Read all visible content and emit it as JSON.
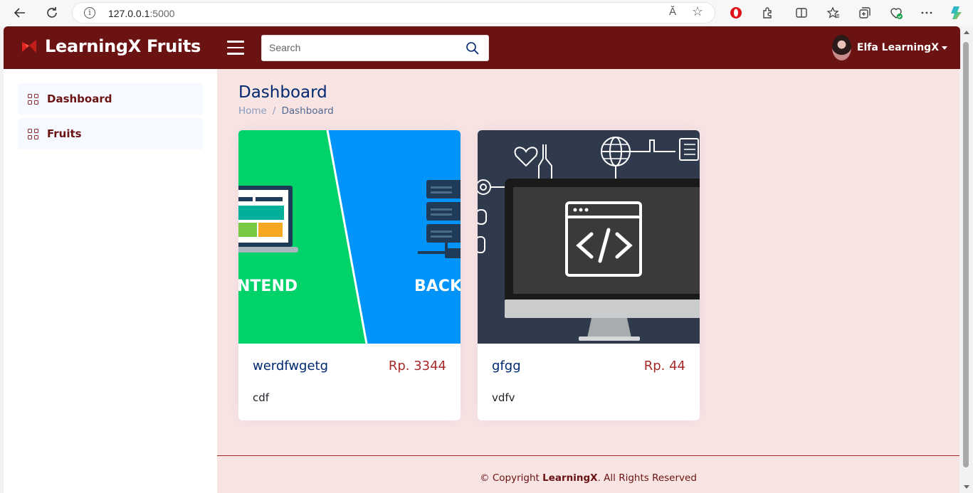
{
  "browser": {
    "url_host": "127.0.0.1",
    "url_port": ":5000",
    "read_aloud": "Ă"
  },
  "header": {
    "app_title": "LearningX Fruits",
    "search_placeholder": "Search",
    "user_name": "Elfa LearningX"
  },
  "sidebar": {
    "items": [
      {
        "label": "Dashboard",
        "icon": "grid-icon"
      },
      {
        "label": "Fruits",
        "icon": "grid-icon"
      }
    ]
  },
  "main": {
    "page_title": "Dashboard",
    "breadcrumb": {
      "home": "Home",
      "separator": "/",
      "current": "Dashboard"
    }
  },
  "cards": [
    {
      "title": "werdfwgetg",
      "price": "Rp. 3344",
      "description": "cdf",
      "image_left_text": "NTEND",
      "image_right_text": "BACK"
    },
    {
      "title": "gfgg",
      "price": "Rp. 44",
      "description": "vdfv"
    }
  ],
  "footer": {
    "prefix": "© Copyright ",
    "brand": "LearningX",
    "suffix": ". All Rights Reserved"
  },
  "colors": {
    "header_bg": "#6b1212",
    "main_bg": "#f9e4e4",
    "title_blue": "#012970",
    "price_red": "#a82a2a"
  }
}
